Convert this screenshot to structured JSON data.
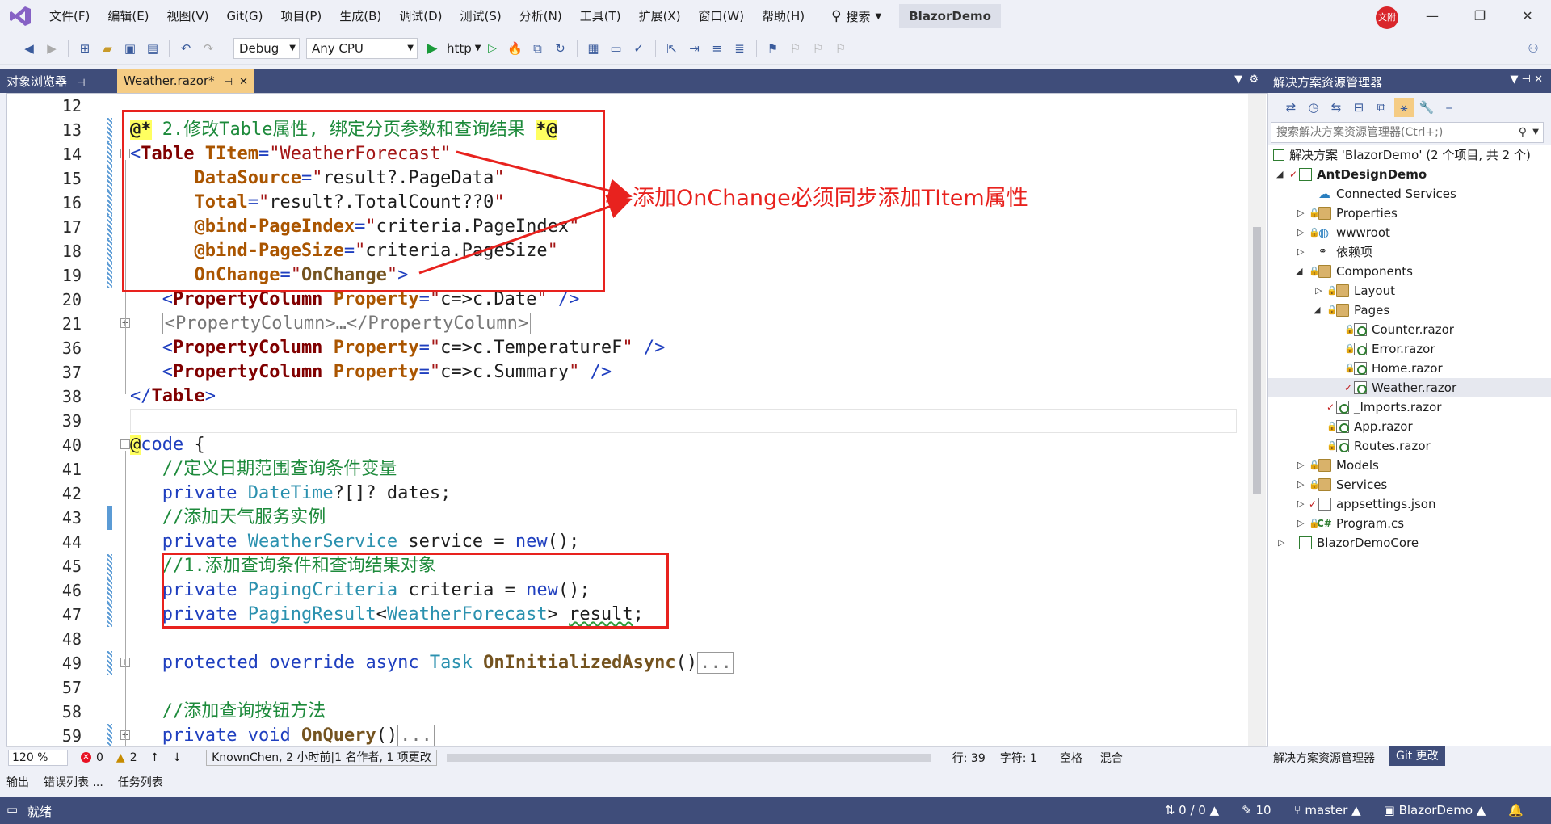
{
  "menubar": {
    "items": [
      "文件(F)",
      "编辑(E)",
      "视图(V)",
      "Git(G)",
      "项目(P)",
      "生成(B)",
      "调试(D)",
      "测试(S)",
      "分析(N)",
      "工具(T)",
      "扩展(X)",
      "窗口(W)",
      "帮助(H)"
    ],
    "search_label": "搜索",
    "solution_name": "BlazorDemo",
    "avatar_text": "文附"
  },
  "toolbar": {
    "config": "Debug",
    "platform": "Any CPU",
    "run_target": "http"
  },
  "tabs": {
    "object_browser": "对象浏览器",
    "active_file": "Weather.razor*"
  },
  "editor": {
    "annotation": "添加OnChange必须同步添加TItem属性",
    "lines": [
      {
        "n": "12"
      },
      {
        "n": "13"
      },
      {
        "n": "14"
      },
      {
        "n": "15"
      },
      {
        "n": "16"
      },
      {
        "n": "17"
      },
      {
        "n": "18"
      },
      {
        "n": "19"
      },
      {
        "n": "20"
      },
      {
        "n": "21"
      },
      {
        "n": "36"
      },
      {
        "n": "37"
      },
      {
        "n": "38"
      },
      {
        "n": "39"
      },
      {
        "n": "40"
      },
      {
        "n": "41"
      },
      {
        "n": "42"
      },
      {
        "n": "43"
      },
      {
        "n": "44"
      },
      {
        "n": "45"
      },
      {
        "n": "46"
      },
      {
        "n": "47"
      },
      {
        "n": "48"
      },
      {
        "n": "49"
      },
      {
        "n": "57"
      },
      {
        "n": "58"
      },
      {
        "n": "59"
      }
    ],
    "status": {
      "zoom": "120 %",
      "errors": "0",
      "warnings": "2",
      "blame": "KnownChen, 2 小时前|1 名作者, 1 项更改",
      "line": "行: 39",
      "col": "字符: 1",
      "whitespace": "空格",
      "line_ending": "混合"
    }
  },
  "solution_explorer": {
    "title": "解决方案资源管理器",
    "search_placeholder": "搜索解决方案资源管理器(Ctrl+;)",
    "tree": [
      {
        "label": "解决方案 'BlazorDemo' (2 个项目, 共 2 个)"
      },
      {
        "label": "AntDesignDemo"
      },
      {
        "label": "Connected Services"
      },
      {
        "label": "Properties"
      },
      {
        "label": "wwwroot"
      },
      {
        "label": "依赖项"
      },
      {
        "label": "Components"
      },
      {
        "label": "Layout"
      },
      {
        "label": "Pages"
      },
      {
        "label": "Counter.razor"
      },
      {
        "label": "Error.razor"
      },
      {
        "label": "Home.razor"
      },
      {
        "label": "Weather.razor"
      },
      {
        "label": "_Imports.razor"
      },
      {
        "label": "App.razor"
      },
      {
        "label": "Routes.razor"
      },
      {
        "label": "Models"
      },
      {
        "label": "Services"
      },
      {
        "label": "appsettings.json"
      },
      {
        "label": "Program.cs"
      },
      {
        "label": "BlazorDemoCore"
      }
    ],
    "bottom_tab_explorer": "解决方案资源管理器",
    "bottom_tab_git": "Git 更改"
  },
  "tool_tabs": [
    "输出",
    "错误列表 ...",
    "任务列表"
  ],
  "statusbar": {
    "ready": "就绪",
    "sync": "0 / 0",
    "edits": "10",
    "branch": "master",
    "repo": "BlazorDemo"
  }
}
